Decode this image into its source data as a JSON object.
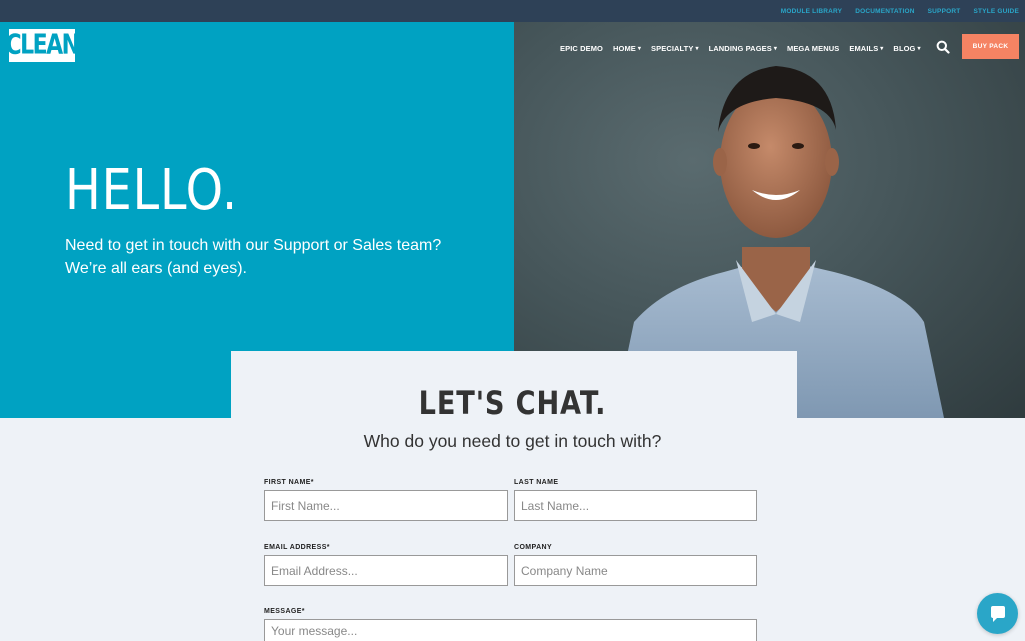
{
  "topbar": {
    "links": [
      "MODULE LIBRARY",
      "DOCUMENTATION",
      "SUPPORT",
      "STYLE GUIDE"
    ]
  },
  "brand": {
    "logo_text": "CLEAN"
  },
  "nav": {
    "items": [
      {
        "label": "EPIC DEMO",
        "dropdown": false
      },
      {
        "label": "HOME",
        "dropdown": true
      },
      {
        "label": "SPECIALTY",
        "dropdown": true
      },
      {
        "label": "LANDING PAGES",
        "dropdown": true
      },
      {
        "label": "MEGA MENUS",
        "dropdown": false
      },
      {
        "label": "EMAILS",
        "dropdown": true
      },
      {
        "label": "BLOG",
        "dropdown": true
      }
    ],
    "buy_label": "BUY PACK"
  },
  "hero": {
    "title": "HELLO.",
    "subtitle_line1": "Need to get in touch with our Support or Sales team?",
    "subtitle_line2": "We’re all ears (and eyes)."
  },
  "form": {
    "title": "LET'S CHAT.",
    "subtitle": "Who do you need to get in touch with?",
    "first_name": {
      "label": "FIRST NAME*",
      "placeholder": "First Name..."
    },
    "last_name": {
      "label": "LAST NAME",
      "placeholder": "Last Name..."
    },
    "email": {
      "label": "EMAIL ADDRESS*",
      "placeholder": "Email Address..."
    },
    "company": {
      "label": "COMPANY",
      "placeholder": "Company Name"
    },
    "message": {
      "label": "MESSAGE*",
      "placeholder": "Your message..."
    }
  },
  "colors": {
    "brand_teal": "#00a2c2",
    "topbar": "#2e4157",
    "accent_orange": "#f58363",
    "page_bg": "#eef2f7"
  }
}
